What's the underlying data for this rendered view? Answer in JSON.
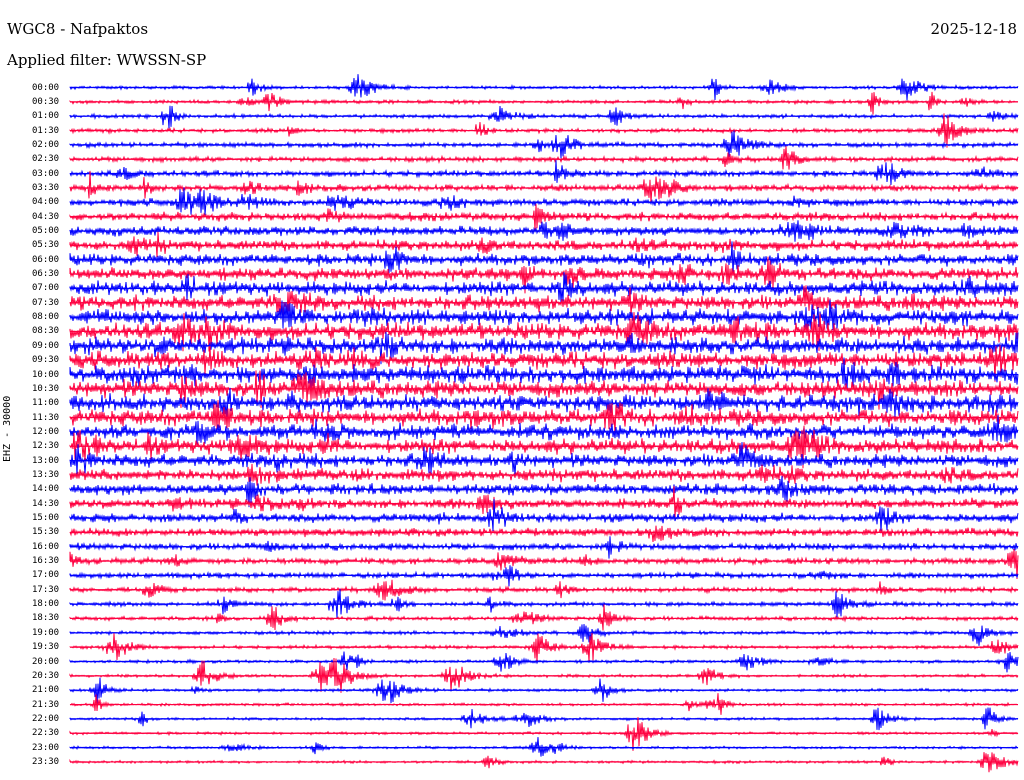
{
  "header": {
    "station": "WGC8 - Nafpaktos",
    "date": "2025-12-18",
    "filter": "Applied filter: WWSSN-SP"
  },
  "axis": {
    "ylabel": "EHZ - 30000"
  },
  "rows": [
    {
      "time": "00:00"
    },
    {
      "time": "00:30"
    },
    {
      "time": "01:00"
    },
    {
      "time": "01:30"
    },
    {
      "time": "02:00"
    },
    {
      "time": "02:30"
    },
    {
      "time": "03:00"
    },
    {
      "time": "03:30"
    },
    {
      "time": "04:00"
    },
    {
      "time": "04:30"
    },
    {
      "time": "05:00"
    },
    {
      "time": "05:30"
    },
    {
      "time": "06:00"
    },
    {
      "time": "06:30"
    },
    {
      "time": "07:00"
    },
    {
      "time": "07:30"
    },
    {
      "time": "08:00"
    },
    {
      "time": "08:30"
    },
    {
      "time": "09:00"
    },
    {
      "time": "09:30"
    },
    {
      "time": "10:00"
    },
    {
      "time": "10:30"
    },
    {
      "time": "11:00"
    },
    {
      "time": "11:30"
    },
    {
      "time": "12:00"
    },
    {
      "time": "12:30"
    },
    {
      "time": "13:00"
    },
    {
      "time": "13:30"
    },
    {
      "time": "14:00"
    },
    {
      "time": "14:30"
    },
    {
      "time": "15:00"
    },
    {
      "time": "15:30"
    },
    {
      "time": "16:00"
    },
    {
      "time": "16:30"
    },
    {
      "time": "17:00"
    },
    {
      "time": "17:30"
    },
    {
      "time": "18:00"
    },
    {
      "time": "18:30"
    },
    {
      "time": "19:00"
    },
    {
      "time": "19:30"
    },
    {
      "time": "20:00"
    },
    {
      "time": "20:30"
    },
    {
      "time": "21:00"
    },
    {
      "time": "21:30"
    },
    {
      "time": "22:00"
    },
    {
      "time": "22:30"
    },
    {
      "time": "23:00"
    },
    {
      "time": "23:30"
    }
  ],
  "colors": {
    "trace_even": "#0000ff",
    "trace_odd": "#ff0040",
    "background": "#ffffff",
    "text": "#000000"
  }
}
